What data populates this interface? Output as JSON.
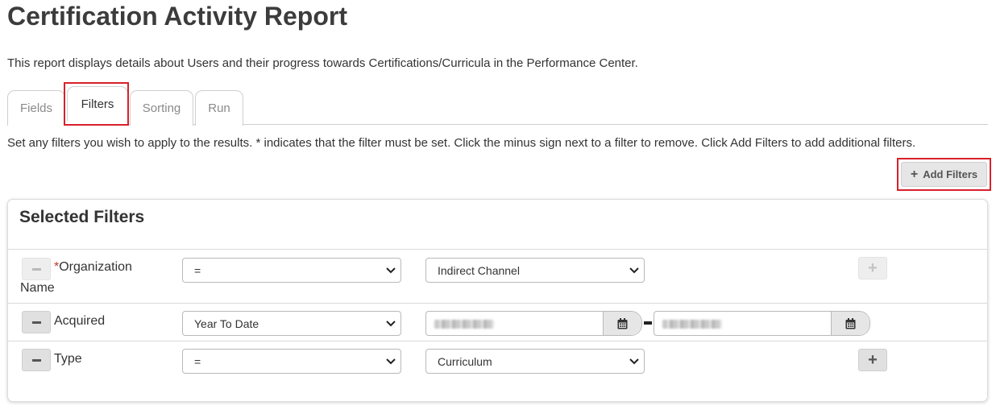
{
  "page": {
    "title": "Certification Activity Report",
    "description": "This report displays details about Users and their progress towards Certifications/Curricula in the Performance Center."
  },
  "tabs": [
    {
      "label": "Fields",
      "active": false
    },
    {
      "label": "Filters",
      "active": true
    },
    {
      "label": "Sorting",
      "active": false
    },
    {
      "label": "Run",
      "active": false
    }
  ],
  "instructions": "Set any filters you wish to apply to the results. * indicates that the filter must be set. Click the minus sign next to a filter to remove. Click Add Filters to add additional filters.",
  "add_filters": {
    "label": "Add Filters",
    "icon": "plus-icon"
  },
  "panel": {
    "title": "Selected Filters",
    "filters": [
      {
        "required_mark": "*",
        "label_line1": "Organization",
        "label_line2": "Name",
        "operator": "=",
        "value": "Indirect Channel",
        "remove_enabled": false,
        "add_enabled": false
      },
      {
        "label": "Acquired",
        "operator": "Year To Date",
        "date_from": "",
        "date_to": "",
        "range_separator": "-",
        "icon": "calendar-icon"
      },
      {
        "label": "Type",
        "operator": "=",
        "value": "Curriculum",
        "remove_enabled": true,
        "add_enabled": true
      }
    ]
  },
  "colors": {
    "highlight": "#d9202a",
    "required": "#c0392b",
    "button_bg": "#e0e0e0"
  }
}
